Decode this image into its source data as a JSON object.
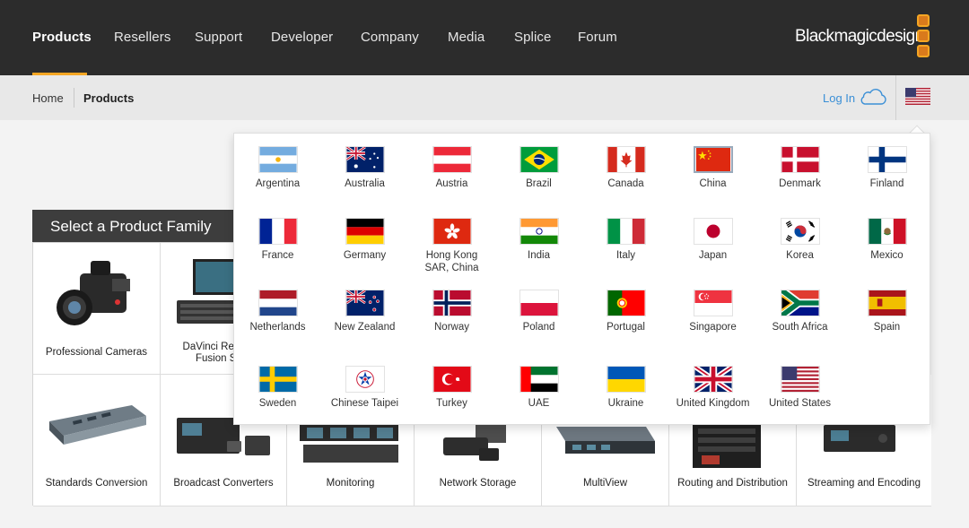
{
  "nav": {
    "items": [
      {
        "label": "Products"
      },
      {
        "label": "Resellers"
      },
      {
        "label": "Support"
      },
      {
        "label": "Developer"
      },
      {
        "label": "Company"
      },
      {
        "label": "Media"
      },
      {
        "label": "Splice"
      },
      {
        "label": "Forum"
      }
    ],
    "active_index": 0,
    "logo_text": "Blackmagicdesign",
    "accent_color": "#f5a623"
  },
  "breadcrumb": {
    "home": "Home",
    "current": "Products"
  },
  "account": {
    "login": "Log In",
    "cloud_icon": "cloud-icon",
    "region_flag": "us-flag-icon"
  },
  "product_family": {
    "title": "Select a Product Family",
    "items": [
      {
        "label": "Professional Cameras"
      },
      {
        "label": "DaVinci Resolve and Fusion Software"
      },
      {
        "label": "Standards Conversion"
      },
      {
        "label": "Broadcast Converters"
      },
      {
        "label": "Monitoring"
      },
      {
        "label": "Network Storage"
      },
      {
        "label": "MultiView"
      },
      {
        "label": "Routing and Distribution"
      },
      {
        "label": "Streaming and Encoding"
      }
    ],
    "visible_partial_labels": [
      "DaVinci Reso",
      "Fusion Sof"
    ]
  },
  "region_selector": {
    "countries": [
      {
        "name": "Argentina"
      },
      {
        "name": "Australia"
      },
      {
        "name": "Austria"
      },
      {
        "name": "Brazil"
      },
      {
        "name": "Canada"
      },
      {
        "name": "China"
      },
      {
        "name": "Denmark"
      },
      {
        "name": "Finland"
      },
      {
        "name": "France"
      },
      {
        "name": "Germany"
      },
      {
        "name": "Hong Kong SAR, China"
      },
      {
        "name": "India"
      },
      {
        "name": "Italy"
      },
      {
        "name": "Japan"
      },
      {
        "name": "Korea"
      },
      {
        "name": "Mexico"
      },
      {
        "name": "Netherlands"
      },
      {
        "name": "New Zealand"
      },
      {
        "name": "Norway"
      },
      {
        "name": "Poland"
      },
      {
        "name": "Portugal"
      },
      {
        "name": "Singapore"
      },
      {
        "name": "South Africa"
      },
      {
        "name": "Spain"
      },
      {
        "name": "Sweden"
      },
      {
        "name": "Chinese Taipei"
      },
      {
        "name": "Turkey"
      },
      {
        "name": "UAE"
      },
      {
        "name": "Ukraine"
      },
      {
        "name": "United Kingdom"
      },
      {
        "name": "United States"
      }
    ],
    "hong_kong_line1": "Hong Kong",
    "hong_kong_line2": "SAR, China"
  }
}
